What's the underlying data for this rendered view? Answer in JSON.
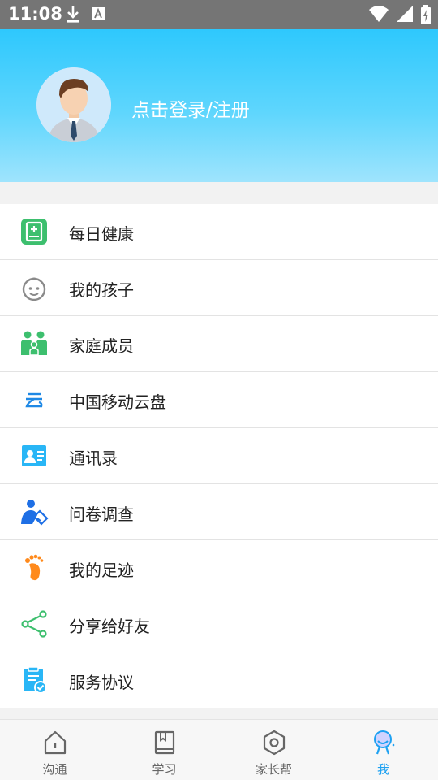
{
  "status_bar": {
    "time": "11:08"
  },
  "header": {
    "login_label": "点击登录/注册"
  },
  "menu": {
    "items": [
      {
        "label": "每日健康",
        "icon": "health-card-icon"
      },
      {
        "label": "我的孩子",
        "icon": "child-face-icon"
      },
      {
        "label": "家庭成员",
        "icon": "family-icon"
      },
      {
        "label": "中国移动云盘",
        "icon": "cloud-disk-icon"
      },
      {
        "label": "通讯录",
        "icon": "contacts-icon"
      },
      {
        "label": "问卷调查",
        "icon": "survey-icon"
      },
      {
        "label": "我的足迹",
        "icon": "footprint-icon"
      },
      {
        "label": "分享给好友",
        "icon": "share-icon"
      },
      {
        "label": "服务协议",
        "icon": "agreement-icon"
      }
    ]
  },
  "tabbar": {
    "tabs": [
      {
        "label": "沟通",
        "icon": "home-icon"
      },
      {
        "label": "学习",
        "icon": "book-icon"
      },
      {
        "label": "家长帮",
        "icon": "hexagon-icon"
      },
      {
        "label": "我",
        "icon": "profile-icon"
      }
    ],
    "active_index": 3,
    "active_color": "#1da1f2",
    "inactive_color": "#666666"
  },
  "colors": {
    "header_top": "#2ec8fd",
    "header_bottom": "#9fe4fd",
    "green": "#3dbf6e",
    "blue": "#1e88e5",
    "orange": "#ff8a1c"
  }
}
